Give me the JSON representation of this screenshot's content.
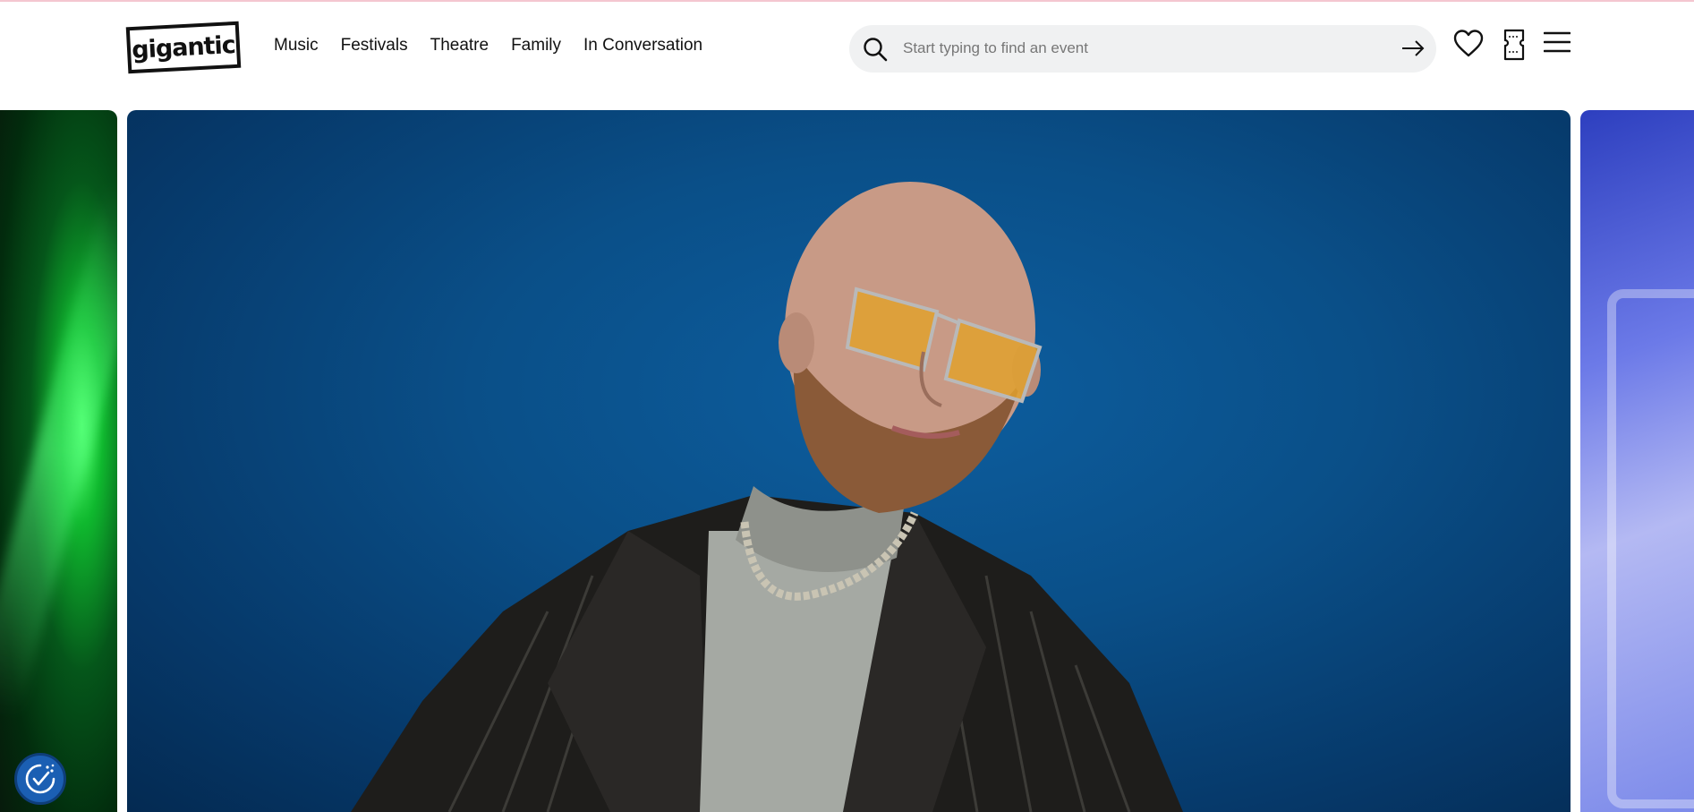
{
  "brand": {
    "logo_text": "gigantic"
  },
  "nav": {
    "items": [
      {
        "label": "Music"
      },
      {
        "label": "Festivals"
      },
      {
        "label": "Theatre"
      },
      {
        "label": "Family"
      },
      {
        "label": "In Conversation"
      }
    ]
  },
  "search": {
    "placeholder": "Start typing to find an event",
    "value": ""
  },
  "header_icons": [
    "search-icon",
    "arrow-right-icon",
    "heart-icon",
    "ticket-icon",
    "hamburger-menu-icon"
  ],
  "carousel": {
    "controls": [
      "chevron-left-icon",
      "chevron-right-icon"
    ]
  },
  "colors": {
    "accent_line": "#f4c6d0",
    "hero_bg": "#0a4f88",
    "search_bg": "#f0f1f2",
    "cookie_button": "#1b5fb3"
  }
}
